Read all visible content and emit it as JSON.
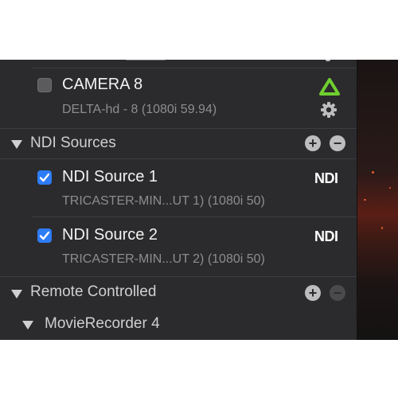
{
  "camera": {
    "name": "CAMERA 8",
    "detail": "DELTA-hd - 8 (1080i 59.94)",
    "checked": false
  },
  "ndi_section": {
    "title": "NDI Sources"
  },
  "ndi_sources": [
    {
      "name": "NDI Source 1",
      "detail": "TRICASTER-MIN...UT 1) (1080i 50)",
      "badge": "NDI",
      "checked": true
    },
    {
      "name": "NDI Source 2",
      "detail": "TRICASTER-MIN...UT 2) (1080i 50)",
      "badge": "NDI",
      "checked": true
    }
  ],
  "remote_section": {
    "title": "Remote Controlled"
  },
  "remote_items": [
    {
      "name": "MovieRecorder 4"
    }
  ],
  "colors": {
    "panel_bg": "#2b2b2d",
    "checkbox_checked": "#2e7cf6",
    "delta_icon": "#6fcf2f"
  }
}
